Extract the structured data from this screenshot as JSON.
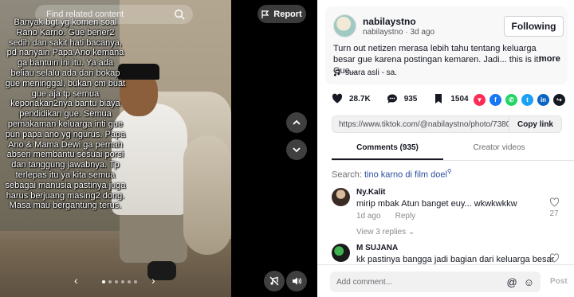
{
  "video": {
    "search_placeholder": "Find related content",
    "report_label": "Report",
    "overlay_caption": "Banyak bgt yg komen soal Rano Karno. Gue bener2 sedih dan sakit hati bacanya, pd nanyain Papa Ano kemana ga bantuin ini itu. Ya ada beliau selalu ada dari bokap gue meninggal, bukan cm buat gue aja tp semua keponakan2nya bantu biaya pendidikan gue. Semua pemakaman keluarga inti gue pun papa ano yg ngurus. Papa Ano & Mama Dewi ga pernah absen membantu sesuai porsi dan tanggung jawabnya. Tp terlepas itu ya kita semua sebagai manusia pastinya juga harus berjuang masing2 dong. Masa mau bergantung terus.",
    "carousel_dot_count": 6,
    "carousel_active_index": 0,
    "prev_arrow": "‹",
    "next_arrow": "›",
    "icons": [
      "search-icon",
      "flag-icon",
      "chevron-up-icon",
      "chevron-down-icon",
      "no-music-icon",
      "volume-icon"
    ]
  },
  "post": {
    "username": "nabilaystno",
    "handle": "nabilaystno",
    "time_ago": "3d ago",
    "meta_separator": " · ",
    "follow_label": "Following",
    "caption": "Turn out netizen merasa lebih tahu tentang keluarga besar gue karena postingan kemaren. Jadi... this is it! Gue...",
    "more_label": "more",
    "sound_label": "suara asli - sa.",
    "likes": "28.7K",
    "comments": "935",
    "saves": "1504",
    "share_icons": [
      {
        "name": "tiktok-share-icon",
        "glyph": "▼",
        "color": "#fe2c55"
      },
      {
        "name": "facebook-icon",
        "glyph": "f",
        "color": "#1877f2"
      },
      {
        "name": "whatsapp-icon",
        "glyph": "✆",
        "color": "#25d366"
      },
      {
        "name": "twitter-icon",
        "glyph": "t",
        "color": "#1da1f2"
      },
      {
        "name": "linkedin-icon",
        "glyph": "in",
        "color": "#0a66c2"
      },
      {
        "name": "share-arrow-icon",
        "glyph": "↪",
        "color": "#161823"
      }
    ],
    "link_url": "https://www.tiktok.com/@nabilaystno/photo/7380997...",
    "copy_link_label": "Copy link"
  },
  "tabs": [
    {
      "label": "Comments (935)",
      "active": true
    },
    {
      "label": "Creator videos",
      "active": false
    }
  ],
  "search_suggestion": {
    "prefix": "Search: ",
    "query": "tino karno di film doel"
  },
  "comments": [
    {
      "author": "Ny.Kalit",
      "text": "mirip mbak Atun banget euy... wkwkwkkw",
      "time": "1d ago",
      "reply_label": "Reply",
      "likes": "27",
      "view_replies": "View 3 replies ⌄"
    },
    {
      "author": "M SUJANA",
      "text": "kk pastinya bangga jadi bagian dari keluarga besar",
      "time": "",
      "reply_label": "",
      "likes": "",
      "view_replies": ""
    }
  ],
  "composer": {
    "placeholder": "Add comment...",
    "mention_glyph": "@",
    "emoji_glyph": "☺",
    "post_label": "Post"
  }
}
